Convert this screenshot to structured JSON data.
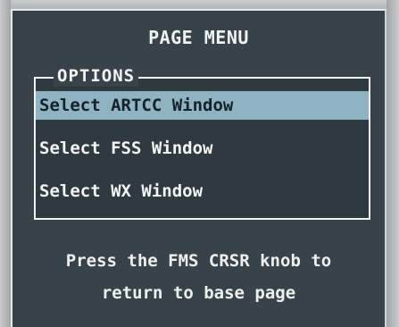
{
  "page_menu": {
    "title": "PAGE MENU",
    "options_label": "OPTIONS",
    "options": [
      {
        "label": "Select ARTCC Window",
        "selected": true
      },
      {
        "label": "Select FSS Window",
        "selected": false
      },
      {
        "label": "Select WX Window",
        "selected": false
      }
    ],
    "hint_line_1": "Press the FMS CRSR knob to",
    "hint_line_2": "return to base page"
  },
  "colors": {
    "background": "#374349",
    "selection": "#8fb3c3",
    "text": "#f2f3f3",
    "bezel": "#c9cbcc"
  }
}
